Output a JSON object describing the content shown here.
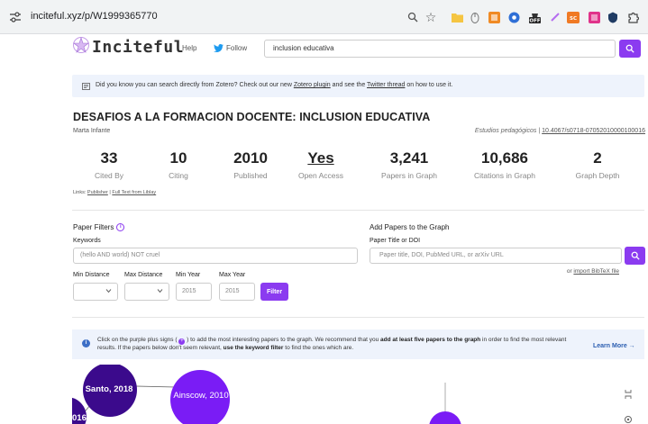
{
  "browser": {
    "url": "inciteful.xyz/p/W1999365770",
    "off_badge": "OFF",
    "ext_label": "SC"
  },
  "header": {
    "logo_text": "Inciteful",
    "help": "Help",
    "follow": "Follow",
    "search_value": "inclusion educativa"
  },
  "notice": {
    "text_before": "Did you know you can search directly from Zotero? Check out our new ",
    "link1": "Zotero plugin",
    "text_mid": " and see the ",
    "link2": "Twitter thread",
    "text_after": " on how to use it."
  },
  "paper": {
    "title": "DESAFIOS A LA FORMACION DOCENTE: INCLUSION EDUCATIVA",
    "author": "Marta Infante",
    "journal": "Estudios pedagógicos",
    "separator": "|",
    "doi": "10.4067/s0718-07052010000100016"
  },
  "stats": [
    {
      "value": "33",
      "label": "Cited By"
    },
    {
      "value": "10",
      "label": "Citing"
    },
    {
      "value": "2010",
      "label": "Published"
    },
    {
      "value": "Yes",
      "label": "Open Access"
    },
    {
      "value": "3,241",
      "label": "Papers in Graph"
    },
    {
      "value": "10,686",
      "label": "Citations in Graph"
    },
    {
      "value": "2",
      "label": "Graph Depth"
    }
  ],
  "links": {
    "prefix": "Links: ",
    "publisher": "Publisher",
    "sep": " | ",
    "full_text": "Full Text from Liblay"
  },
  "filters": {
    "title": "Paper Filters",
    "info": "i",
    "keywords_label": "Keywords",
    "keywords_placeholder": "(hello AND world) NOT cruel",
    "min_distance_label": "Min Distance",
    "max_distance_label": "Max Distance",
    "min_year_label": "Min Year",
    "max_year_label": "Max Year",
    "min_year_value": "2015",
    "max_year_value": "2015",
    "filter_button": "Filter"
  },
  "add_papers": {
    "title": "Add Papers to the Graph",
    "label": "Paper Title or DOI",
    "placeholder": "Paper title, DOI, PubMed URL, or arXiv URL",
    "or_text": "or ",
    "import_link": "import BibTeX file"
  },
  "guide": {
    "t1": "Click on the purple plus signs (",
    "plus": "+",
    "t2": ") to add the most interesting papers to the graph. We recommend that you ",
    "b1": "add at least five papers to the graph",
    "t3": " in order to find the most relevant results. If the papers below don't seem relevant, ",
    "b2": "use the keyword filter",
    "t4": " to find the ones which are.",
    "info": "i",
    "learn_more": "Learn More →"
  },
  "graph": {
    "nodes": [
      {
        "label": "Santo, 2018"
      },
      {
        "label": "Ainscow, 2010"
      },
      {
        "label": "016"
      }
    ],
    "colors": {
      "node_dark": "#3b0a8c",
      "node_bright": "#7a1cf5",
      "edge": "#666666"
    }
  },
  "colors": {
    "accent": "#8b3bf0",
    "banner": "#eef3fc",
    "link_blue": "#2a5db0",
    "twitter": "#1d9bf0"
  }
}
